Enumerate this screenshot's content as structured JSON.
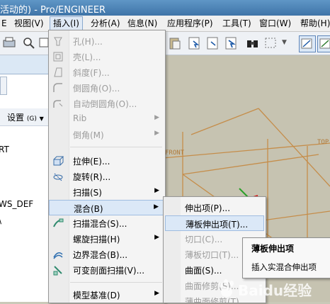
{
  "window": {
    "title": "活动的) - Pro/ENGINEER"
  },
  "menubar": {
    "items": [
      {
        "label": "E"
      },
      {
        "label": "视图(V)"
      },
      {
        "label": "插入(I)"
      },
      {
        "label": "分析(A)"
      },
      {
        "label": "信息(N)"
      },
      {
        "label": "应用程序(P)"
      },
      {
        "label": "工具(T)"
      },
      {
        "label": "窗口(W)"
      },
      {
        "label": "帮助(H)"
      }
    ]
  },
  "left_panel": {
    "settings_label": "设置",
    "settings_shortcut": "(G)",
    "tree_items": [
      "RT",
      "WS_DEF",
      "\\"
    ]
  },
  "insert_menu": {
    "items": [
      {
        "label": "孔(H)...",
        "disabled": true,
        "icon": "hole-icon"
      },
      {
        "label": "壳(L)...",
        "disabled": true,
        "icon": "shell-icon"
      },
      {
        "label": "斜度(F)...",
        "disabled": true,
        "icon": "draft-icon"
      },
      {
        "label": "倒圆角(O)...",
        "disabled": true,
        "icon": "round-icon"
      },
      {
        "label": "自动倒圆角(O)...",
        "disabled": true,
        "icon": "auto-round-icon"
      },
      {
        "label": "Rib",
        "disabled": true,
        "submenu": true
      },
      {
        "label": "倒角(M)",
        "disabled": true,
        "submenu": true
      },
      {
        "label": "拉伸(E)...",
        "icon": "extrude-icon"
      },
      {
        "label": "旋转(R)...",
        "icon": "revolve-icon"
      },
      {
        "label": "扫描(S)",
        "submenu": true
      },
      {
        "label": "混合(B)",
        "submenu": true,
        "highlighted": true
      },
      {
        "label": "扫描混合(S)...",
        "icon": "swept-blend-icon"
      },
      {
        "label": "螺旋扫描(H)",
        "submenu": true
      },
      {
        "label": "边界混合(B)...",
        "icon": "boundary-blend-icon"
      },
      {
        "label": "可变剖面扫描(V)...",
        "icon": "variable-sweep-icon"
      },
      {
        "label": "模型基准(D)",
        "submenu": true
      }
    ]
  },
  "blend_submenu": {
    "items": [
      {
        "label": "伸出项(P)..."
      },
      {
        "label": "薄板伸出项(T)...",
        "highlighted": true
      },
      {
        "label": "切口(C)...",
        "disabled": true
      },
      {
        "label": "薄板切口(T)...",
        "disabled": true
      },
      {
        "label": "曲面(S)..."
      },
      {
        "label": "曲面修剪(S)...",
        "disabled": true
      },
      {
        "label": "薄曲面修剪(T)...",
        "disabled": true
      }
    ]
  },
  "tooltip": {
    "title": "薄板伸出项",
    "description": "插入实混合伸出项"
  },
  "viewport": {
    "datum_front": "FRONT",
    "datum_top": "TOP"
  },
  "watermark": {
    "text": "Baidu经验"
  },
  "colors": {
    "titlebar": "#4a7fb3",
    "viewport_bg": "#c6c3b1",
    "datum_lines": "#c58d4a",
    "menu_highlight": "#dbe8f7"
  }
}
